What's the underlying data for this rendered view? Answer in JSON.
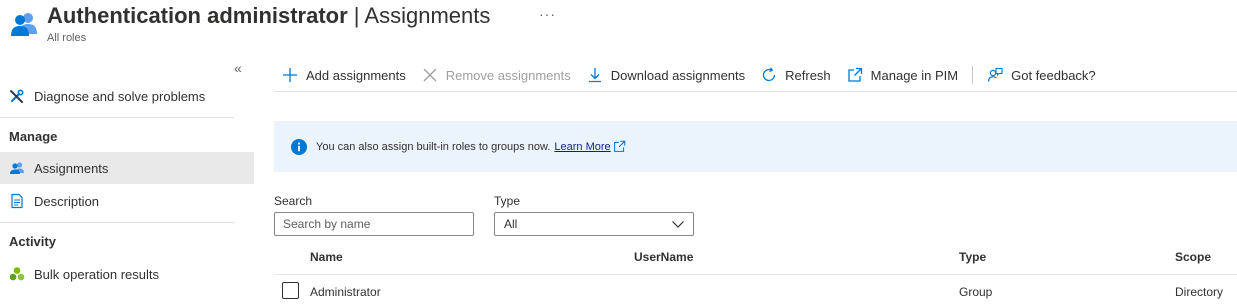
{
  "header": {
    "title_main": "Authentication administrator",
    "title_rest": " | Assignments",
    "more_label": "···",
    "subtitle": "All roles"
  },
  "sidebar": {
    "collapse_label": "«",
    "items": [
      {
        "label": "Diagnose and solve problems",
        "icon": "wrench-icon"
      },
      {
        "label": "Assignments",
        "icon": "users-icon",
        "active": true
      },
      {
        "label": "Description",
        "icon": "document-icon"
      },
      {
        "label": "Bulk operation results",
        "icon": "bulk-results-icon"
      }
    ],
    "sections": [
      "Manage",
      "Activity"
    ]
  },
  "toolbar": {
    "add_label": "Add assignments",
    "remove_label": "Remove assignments",
    "download_label": "Download assignments",
    "refresh_label": "Refresh",
    "pim_label": "Manage in PIM",
    "feedback_label": "Got feedback?"
  },
  "banner": {
    "message": "You can also assign built-in roles to groups now.",
    "link": "Learn More"
  },
  "filters": {
    "search_label": "Search",
    "search_placeholder": "Search by name",
    "search_value": "",
    "type_label": "Type",
    "type_value": "All"
  },
  "table": {
    "columns": [
      "Name",
      "UserName",
      "Type",
      "Scope"
    ],
    "rows": [
      {
        "name": "Administrator",
        "username": "",
        "type": "Group",
        "scope": "Directory"
      }
    ]
  },
  "colors": {
    "accent": "#0078d4",
    "banner_bg": "#ebf3fc",
    "active_nav": "#e9e9e9",
    "link": "#0f1f8a"
  }
}
